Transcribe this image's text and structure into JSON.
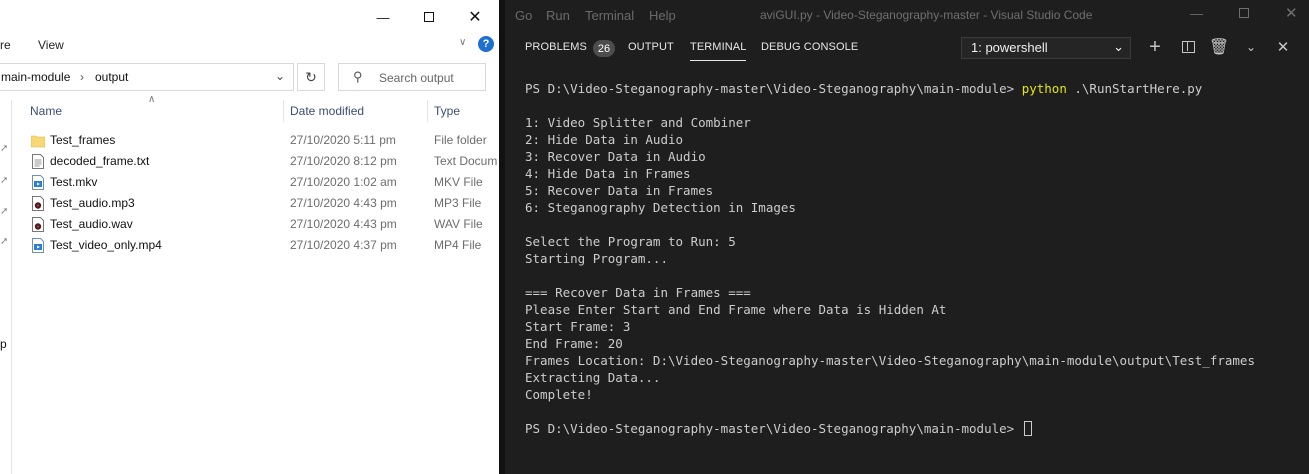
{
  "explorer": {
    "ribbon": {
      "tab_partial": "re",
      "view_tab": "View"
    },
    "address": {
      "crumb_parent": "main-module",
      "crumb_current": "output"
    },
    "search": {
      "placeholder": "Search output"
    },
    "nav_partial": "p",
    "columns": {
      "name": "Name",
      "date": "Date modified",
      "type": "Type"
    },
    "files": [
      {
        "name": "Test_frames",
        "date": "27/10/2020 5:11 pm",
        "type": "File folder",
        "icon": "folder-icon"
      },
      {
        "name": "decoded_frame.txt",
        "date": "27/10/2020 8:12 pm",
        "type": "Text Docum",
        "icon": "text-file-icon"
      },
      {
        "name": "Test.mkv",
        "date": "27/10/2020 1:02 am",
        "type": "MKV File",
        "icon": "video-file-icon"
      },
      {
        "name": "Test_audio.mp3",
        "date": "27/10/2020 4:43 pm",
        "type": "MP3 File",
        "icon": "audio-file-icon"
      },
      {
        "name": "Test_audio.wav",
        "date": "27/10/2020 4:43 pm",
        "type": "WAV File",
        "icon": "audio-file-icon"
      },
      {
        "name": "Test_video_only.mp4",
        "date": "27/10/2020 4:37 pm",
        "type": "MP4 File",
        "icon": "video-file-icon"
      }
    ]
  },
  "vscode": {
    "menu": [
      "Go",
      "Run",
      "Terminal",
      "Help"
    ],
    "window_title": "aviGUI.py - Video-Steganography-master - Visual Studio Code",
    "tabs": {
      "problems": "PROBLEMS",
      "problems_count": "26",
      "output": "OUTPUT",
      "terminal": "TERMINAL",
      "debug_console": "DEBUG CONSOLE"
    },
    "shell_select": "1: powershell",
    "terminal": {
      "prompt1": "PS D:\\Video-Steganography-master\\Video-Steganography\\main-module> ",
      "command": "python",
      "command_arg": " .\\RunStartHere.py",
      "lines": [
        "",
        "1: Video Splitter and Combiner",
        "2: Hide Data in Audio",
        "3: Recover Data in Audio",
        "4: Hide Data in Frames",
        "5: Recover Data in Frames",
        "6: Steganography Detection in Images",
        "",
        "Select the Program to Run: 5",
        "Starting Program...",
        "",
        "=== Recover Data in Frames ===",
        "Please Enter Start and End Frame where Data is Hidden At",
        "Start Frame: 3",
        "End Frame: 20",
        "Frames Location: D:\\Video-Steganography-master\\Video-Steganography\\main-module\\output\\Test_frames",
        "Extracting Data...",
        "Complete!",
        ""
      ],
      "prompt2": "PS D:\\Video-Steganography-master\\Video-Steganography\\main-module> "
    }
  }
}
